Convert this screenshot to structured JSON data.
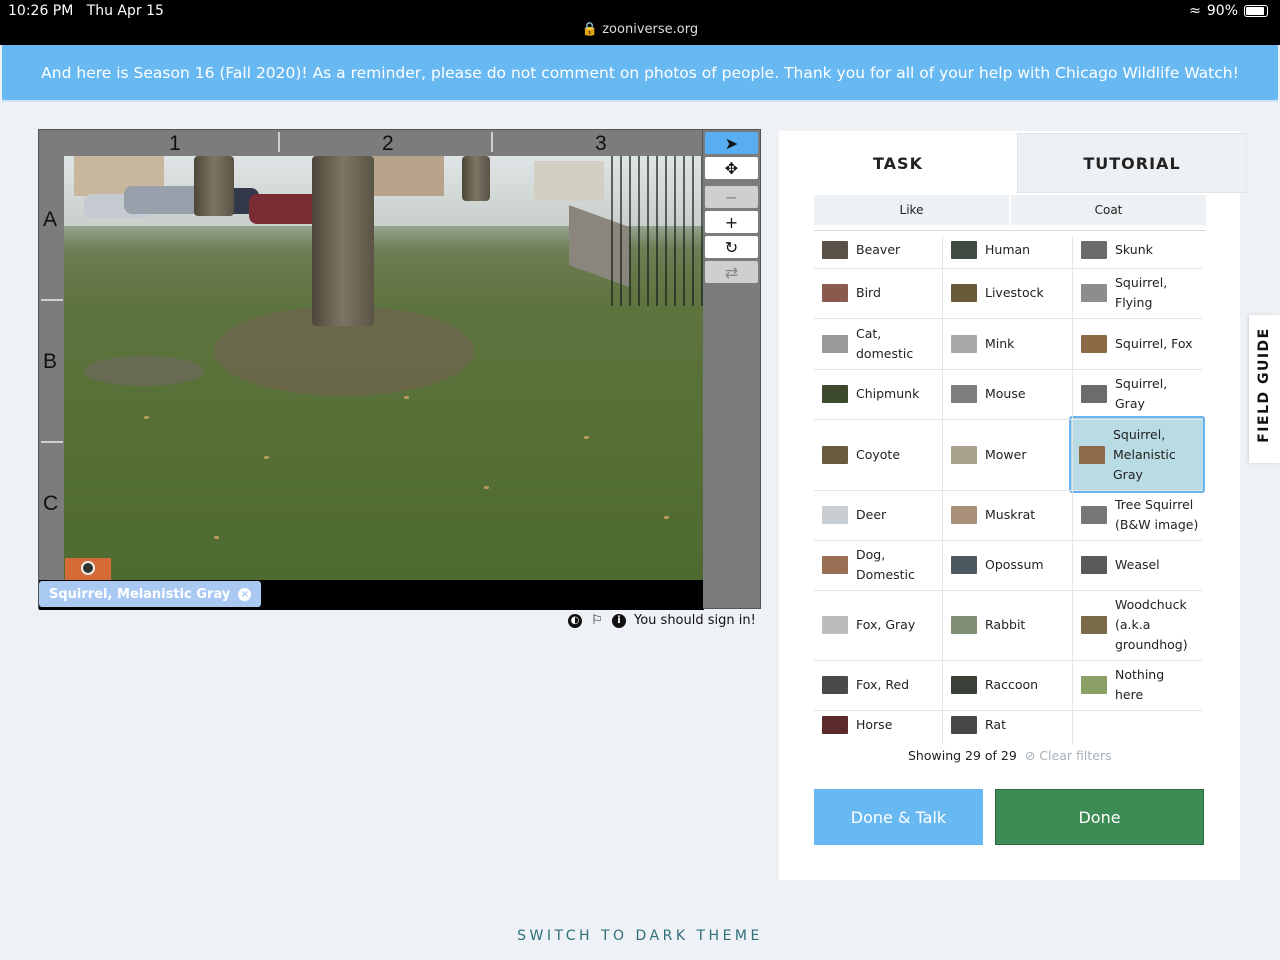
{
  "status": {
    "time": "10:26 PM",
    "date": "Thu Apr 15",
    "url": "zooniverse.org",
    "battery": "90%"
  },
  "banner": {
    "text": "And here is Season 16 (Fall 2020)! As a reminder, please do not comment on photos of people. Thank you for all of your help with Chicago Wildlife Watch!"
  },
  "viewer": {
    "columns": [
      "1",
      "2",
      "3"
    ],
    "rows": [
      "A",
      "B",
      "C"
    ],
    "selected_chip": "Squirrel, Melanistic Gray",
    "chip_remove": "×",
    "meta_text": "You should sign in!",
    "tool_icons": [
      "pointer-icon",
      "move-icon",
      "zoom-out-icon",
      "zoom-in-icon",
      "rotate-icon",
      "reset-icon"
    ]
  },
  "panel": {
    "tabs": [
      "TASK",
      "TUTORIAL"
    ],
    "filters": [
      "Like",
      "Coat"
    ],
    "choices": [
      {
        "label": "Beaver",
        "color": "#5b5046"
      },
      {
        "label": "Human",
        "color": "#3f4a42"
      },
      {
        "label": "Skunk",
        "color": "#6a6a6a"
      },
      {
        "label": "Bird",
        "color": "#8a5a4e"
      },
      {
        "label": "Livestock",
        "color": "#6b5a3a"
      },
      {
        "label": "Squirrel,\nFlying",
        "color": "#8d8d8d"
      },
      {
        "label": "Cat,\ndomestic",
        "color": "#9a9a9a"
      },
      {
        "label": "Mink",
        "color": "#a8a8a8"
      },
      {
        "label": "Squirrel, Fox",
        "color": "#8b6b45"
      },
      {
        "label": "Chipmunk",
        "color": "#3d4a2e"
      },
      {
        "label": "Mouse",
        "color": "#7d7d7d"
      },
      {
        "label": "Squirrel,\nGray",
        "color": "#6c6c6c"
      },
      {
        "label": "Coyote",
        "color": "#6b5a3e"
      },
      {
        "label": "Mower",
        "color": "#a8a08a"
      },
      {
        "label": "Squirrel,\nMelanistic\nGray",
        "color": "#8f6a48"
      },
      {
        "label": "Deer",
        "color": "#c9ced3"
      },
      {
        "label": "Muskrat",
        "color": "#a8907a"
      },
      {
        "label": "Tree Squirrel\n(B&W image)",
        "color": "#777777"
      },
      {
        "label": "Dog,\nDomestic",
        "color": "#9a7055"
      },
      {
        "label": "Opossum",
        "color": "#4c5a5f"
      },
      {
        "label": "Weasel",
        "color": "#5a5a5a"
      },
      {
        "label": "Fox, Gray",
        "color": "#bcbcbc"
      },
      {
        "label": "Rabbit",
        "color": "#7f8f76"
      },
      {
        "label": "Woodchuck\n(a.k.a\ngroundhog)",
        "color": "#7a6a4a"
      },
      {
        "label": "Fox, Red",
        "color": "#4a4a4a"
      },
      {
        "label": "Raccoon",
        "color": "#3a3f38"
      },
      {
        "label": "Nothing\nhere",
        "color": "#8aa066"
      },
      {
        "label": "Horse",
        "color": "#5a2a2a"
      },
      {
        "label": "Rat",
        "color": "#474747"
      }
    ],
    "selected_index": 14,
    "showing": "Showing 29 of 29",
    "clear_filters": "Clear filters",
    "done_talk": "Done & Talk",
    "done": "Done"
  },
  "field_guide": "FIELD GUIDE",
  "dark_theme": "SWITCH TO DARK THEME"
}
